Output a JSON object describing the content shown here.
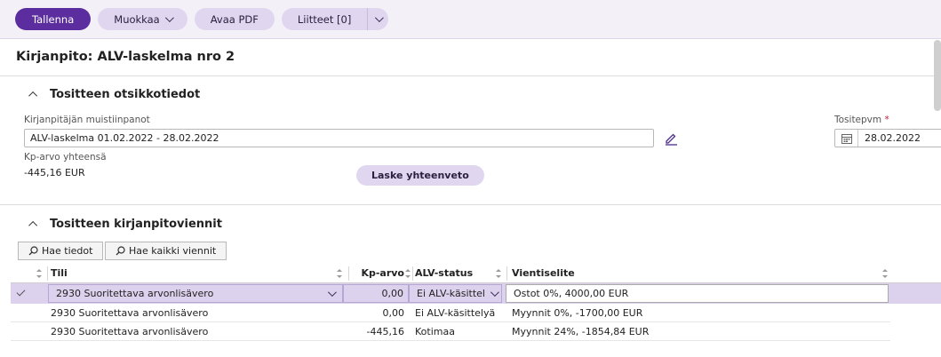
{
  "toolbar": {
    "save": "Tallenna",
    "edit": "Muokkaa",
    "open_pdf": "Avaa PDF",
    "attachments": "Liitteet [0]"
  },
  "page": {
    "title": "Kirjanpito: ALV-laskelma nro 2"
  },
  "header_section": {
    "title": "Tositteen otsikkotiedot",
    "notes_label": "Kirjanpitäjän muistiinpanot",
    "notes_value": "ALV-laskelma 01.02.2022 - 28.02.2022",
    "total_label": "Kp-arvo yhteensä",
    "total_value": "-445,16 EUR",
    "summary_button": "Laske yhteenveto",
    "date_label": "Tositepvm",
    "date_required": "*",
    "date_value": "28.02.2022"
  },
  "entries_section": {
    "title": "Tositteen kirjanpitoviennit",
    "fetch_button": "Hae tiedot",
    "fetch_all_button": "Hae kaikki viennit",
    "columns": {
      "account": "Tili",
      "amount": "Kp-arvo",
      "vat_status": "ALV-status",
      "description": "Vientiselite"
    },
    "rows": [
      {
        "account": "2930 Suoritettava arvonlisävero",
        "amount": "0,00",
        "vat_status": "Ei ALV-käsittel",
        "description": "Ostot 0%, 4000,00 EUR"
      },
      {
        "account": "2930 Suoritettava arvonlisävero",
        "amount": "0,00",
        "vat_status": "Ei ALV-käsittelyä",
        "description": "Myynnit 0%, -1700,00 EUR"
      },
      {
        "account": "2930 Suoritettava arvonlisävero",
        "amount": "-445,16",
        "vat_status": "Kotimaa",
        "description": "Myynnit 24%, -1854,84 EUR"
      }
    ]
  },
  "colors": {
    "primary": "#5b2d9e",
    "secondary_button": "#e0d6f0",
    "selected_row": "#ddd2ee",
    "required": "#c0223b"
  }
}
